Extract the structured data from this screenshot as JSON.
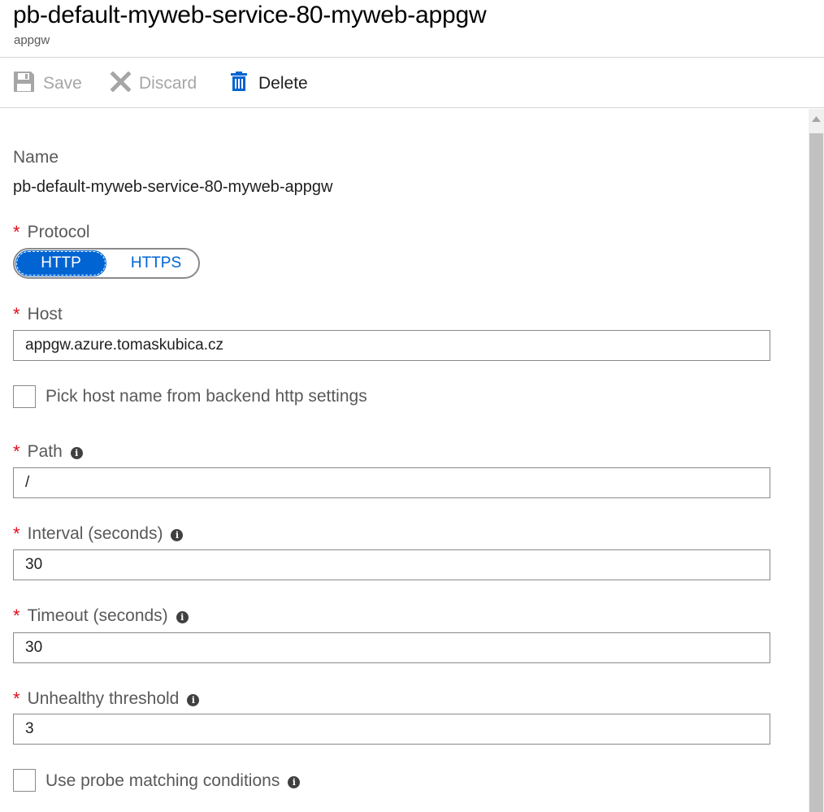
{
  "header": {
    "title": "pb-default-myweb-service-80-myweb-appgw",
    "subtitle": "appgw"
  },
  "toolbar": {
    "save_label": "Save",
    "discard_label": "Discard",
    "delete_label": "Delete"
  },
  "form": {
    "name_label": "Name",
    "name_value": "pb-default-myweb-service-80-myweb-appgw",
    "required_marker": "*",
    "protocol_label": "Protocol",
    "protocol_options": [
      "HTTP",
      "HTTPS"
    ],
    "protocol_selected": "HTTP",
    "host_label": "Host",
    "host_value": "appgw.azure.tomaskubica.cz",
    "pick_host_label": "Pick host name from backend http settings",
    "pick_host_checked": false,
    "path_label": "Path",
    "path_value": "/",
    "interval_label": "Interval (seconds)",
    "interval_value": "30",
    "timeout_label": "Timeout (seconds)",
    "timeout_value": "30",
    "unhealthy_label": "Unhealthy threshold",
    "unhealthy_value": "3",
    "probe_matching_label": "Use probe matching conditions",
    "probe_matching_checked": false,
    "info_glyph": "i"
  },
  "colors": {
    "accent": "#0064d2",
    "required": "#e00b1c",
    "disabled_text": "#a6a6a6"
  },
  "icons": [
    "save-icon",
    "discard-icon",
    "delete-icon",
    "info-icon",
    "scroll-up-icon"
  ]
}
